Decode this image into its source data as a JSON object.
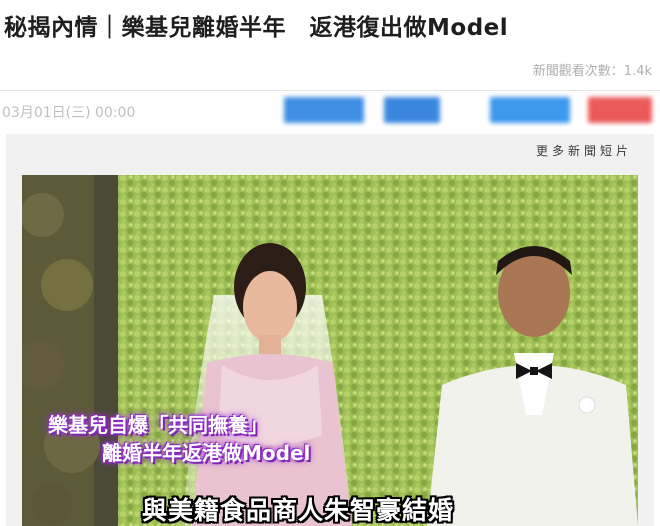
{
  "article": {
    "title": "秘揭內情｜樂基兒離婚半年　返港復出做Model",
    "view_count": "新聞觀看次數：1.4k",
    "date": "03月01日(三) 00:00"
  },
  "share": {
    "colors": [
      "#3f8fe4",
      "#3a86df",
      "#3e98ec",
      "#ea5a5a"
    ]
  },
  "video": {
    "more_news_label": "更多新聞短片",
    "caption_line1": "樂基兒自爆「共同撫養」",
    "caption_line2": "離婚半年返港做Model",
    "subtitle": "與美籍食品商人朱智豪結婚"
  }
}
